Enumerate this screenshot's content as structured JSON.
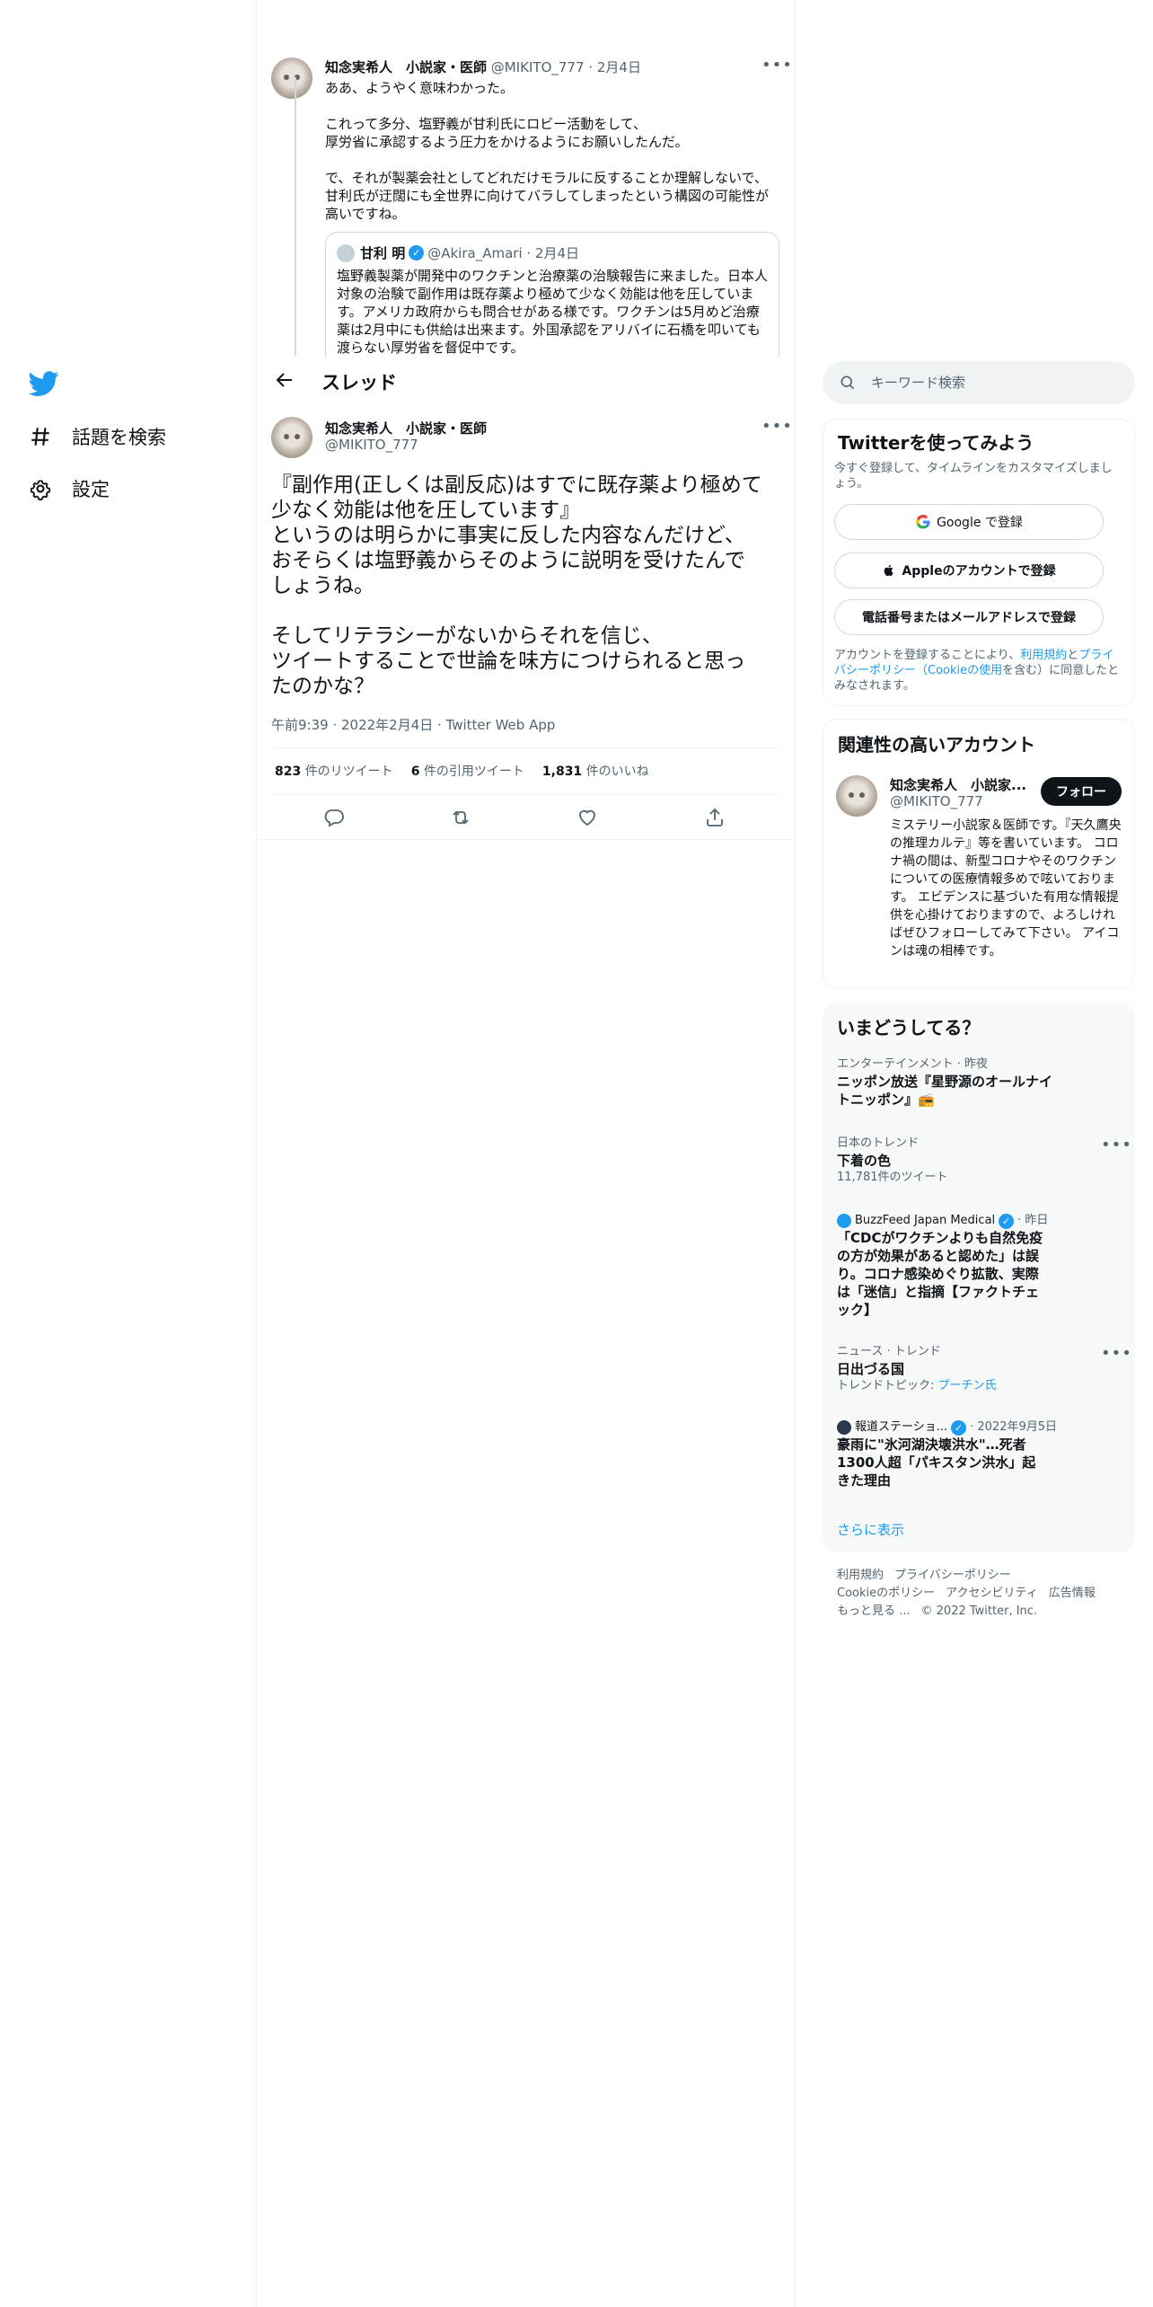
{
  "nav": {
    "items": [
      {
        "label": "話題を検索",
        "icon": "hashtag-icon"
      },
      {
        "label": "設定",
        "icon": "gear-icon"
      }
    ]
  },
  "prev_tweet": {
    "author_name": "知念実希人　小説家・医師",
    "handle": "@MIKITO_777",
    "date": "2月4日",
    "text": "ああ、ようやく意味わかった。\n\nこれって多分、塩野義が甘利氏にロビー活動をして、\n厚労省に承認するよう圧力をかけるようにお願いしたんだ。\n\nで、それが製薬会社としてどれだけモラルに反することか理解しないで、\n甘利氏が迂闊にも全世界に向けてバラしてしまったという構図の可能性が\n高いですね。",
    "quote": {
      "author_name": "甘利 明",
      "handle": "@Akira_Amari",
      "date": "2月4日",
      "text": "塩野義製薬が開発中のワクチンと治療薬の治験報告に来ました。日本人\n対象の治験で副作用は既存薬より極めて少なく効能は他を圧していま\nす。アメリカ政府からも問合せがある様です。ワクチンは5月めど治療\n薬は2月中にも供給は出来ます。外国承認をアリバイに石橋を叩いても\n渡らない厚労省を督促中です。"
    }
  },
  "thread_header": {
    "title": "スレッド"
  },
  "main_tweet": {
    "author_name": "知念実希人　小説家・医師",
    "handle": "@MIKITO_777",
    "text": "『副作用(正しくは副反応)はすでに既存薬より極めて\n少なく効能は他を圧しています』\nというのは明らかに事実に反した内容なんだけど、\nおそらくは塩野義からそのように説明を受けたんで\nしょうね。\n\nそしてリテラシーがないからそれを信じ、\nツイートすることで世論を味方につけられると思っ\nたのかな？",
    "timestamp": "午前9:39 · 2022年2月4日 · Twitter Web App",
    "stats": {
      "retweets_count": "823",
      "retweets_label": "件のリツイート",
      "quotes_count": "6",
      "quotes_label": "件の引用ツイート",
      "likes_count": "1,831",
      "likes_label": "件のいいね"
    }
  },
  "search": {
    "placeholder": "キーワード検索"
  },
  "signup": {
    "title": "Twitterを使ってみよう",
    "subtitle": "今すぐ登録して、タイムラインをカスタマイズしましょう。",
    "google_label": "Google で登録",
    "apple_label": "Appleのアカウントで登録",
    "phone_label": "電話番号またはメールアドレスで登録",
    "terms_prefix": "アカウントを登録することにより、",
    "terms_link": "利用規約",
    "terms_and": "と",
    "privacy_link": "プライバシーポリシー",
    "cookie_prefix": "（",
    "cookie_link": "Cookieの使用",
    "terms_suffix": "を含む）に同意したとみなされます。"
  },
  "related": {
    "title": "関連性の高いアカウント",
    "name": "知念実希人　小説家...",
    "handle": "@MIKITO_777",
    "follow_label": "フォロー",
    "bio": "ミステリー小説家＆医師です。『天久鷹央の推理カルテ』等を書いています。 コロナ禍の間は、新型コロナやそのワクチンについての医療情報多めで呟いております。 エビデンスに基づいた有用な情報提供を心掛けておりますので、よろしければぜひフォローしてみて下さい。 アイコンは魂の相棒です。"
  },
  "trends": {
    "title": "いまどうしてる？",
    "items": [
      {
        "meta": "エンターテインメント · 昨夜",
        "title": "ニッポン放送『星野源のオールナイトニッポン』📻"
      },
      {
        "meta": "日本のトレンド",
        "title": "下着の色",
        "sub": "11,781件のツイート"
      },
      {
        "source": "BuzzFeed Japan Medical",
        "meta": "· 昨日",
        "title": "「CDCがワクチンよりも自然免疫の方が効果があると認めた」は誤り。コロナ感染めぐり拡散、実際は「迷信」と指摘【ファクトチェック】"
      },
      {
        "meta": "ニュース · トレンド",
        "title": "日出づる国",
        "sub_prefix": "トレンドトピック: ",
        "sub_link": "プーチン氏"
      },
      {
        "source": "報道ステーショ...",
        "meta": "· 2022年9月5日",
        "title": "豪雨に\"氷河湖決壊洪水\"…死者1300人超「パキスタン洪水」起きた理由"
      }
    ],
    "show_more": "さらに表示"
  },
  "footer": {
    "links_row1": [
      "利用規約",
      "プライバシーポリシー"
    ],
    "links_row2": [
      "Cookieのポリシー",
      "アクセシビリティ",
      "広告情報"
    ],
    "more": "もっと見る ...",
    "copyright": "© 2022 Twitter, Inc."
  },
  "colors": {
    "accent": "#1d9bf0",
    "text": "#0f1419",
    "muted": "#536471",
    "border": "#eff3f4"
  }
}
